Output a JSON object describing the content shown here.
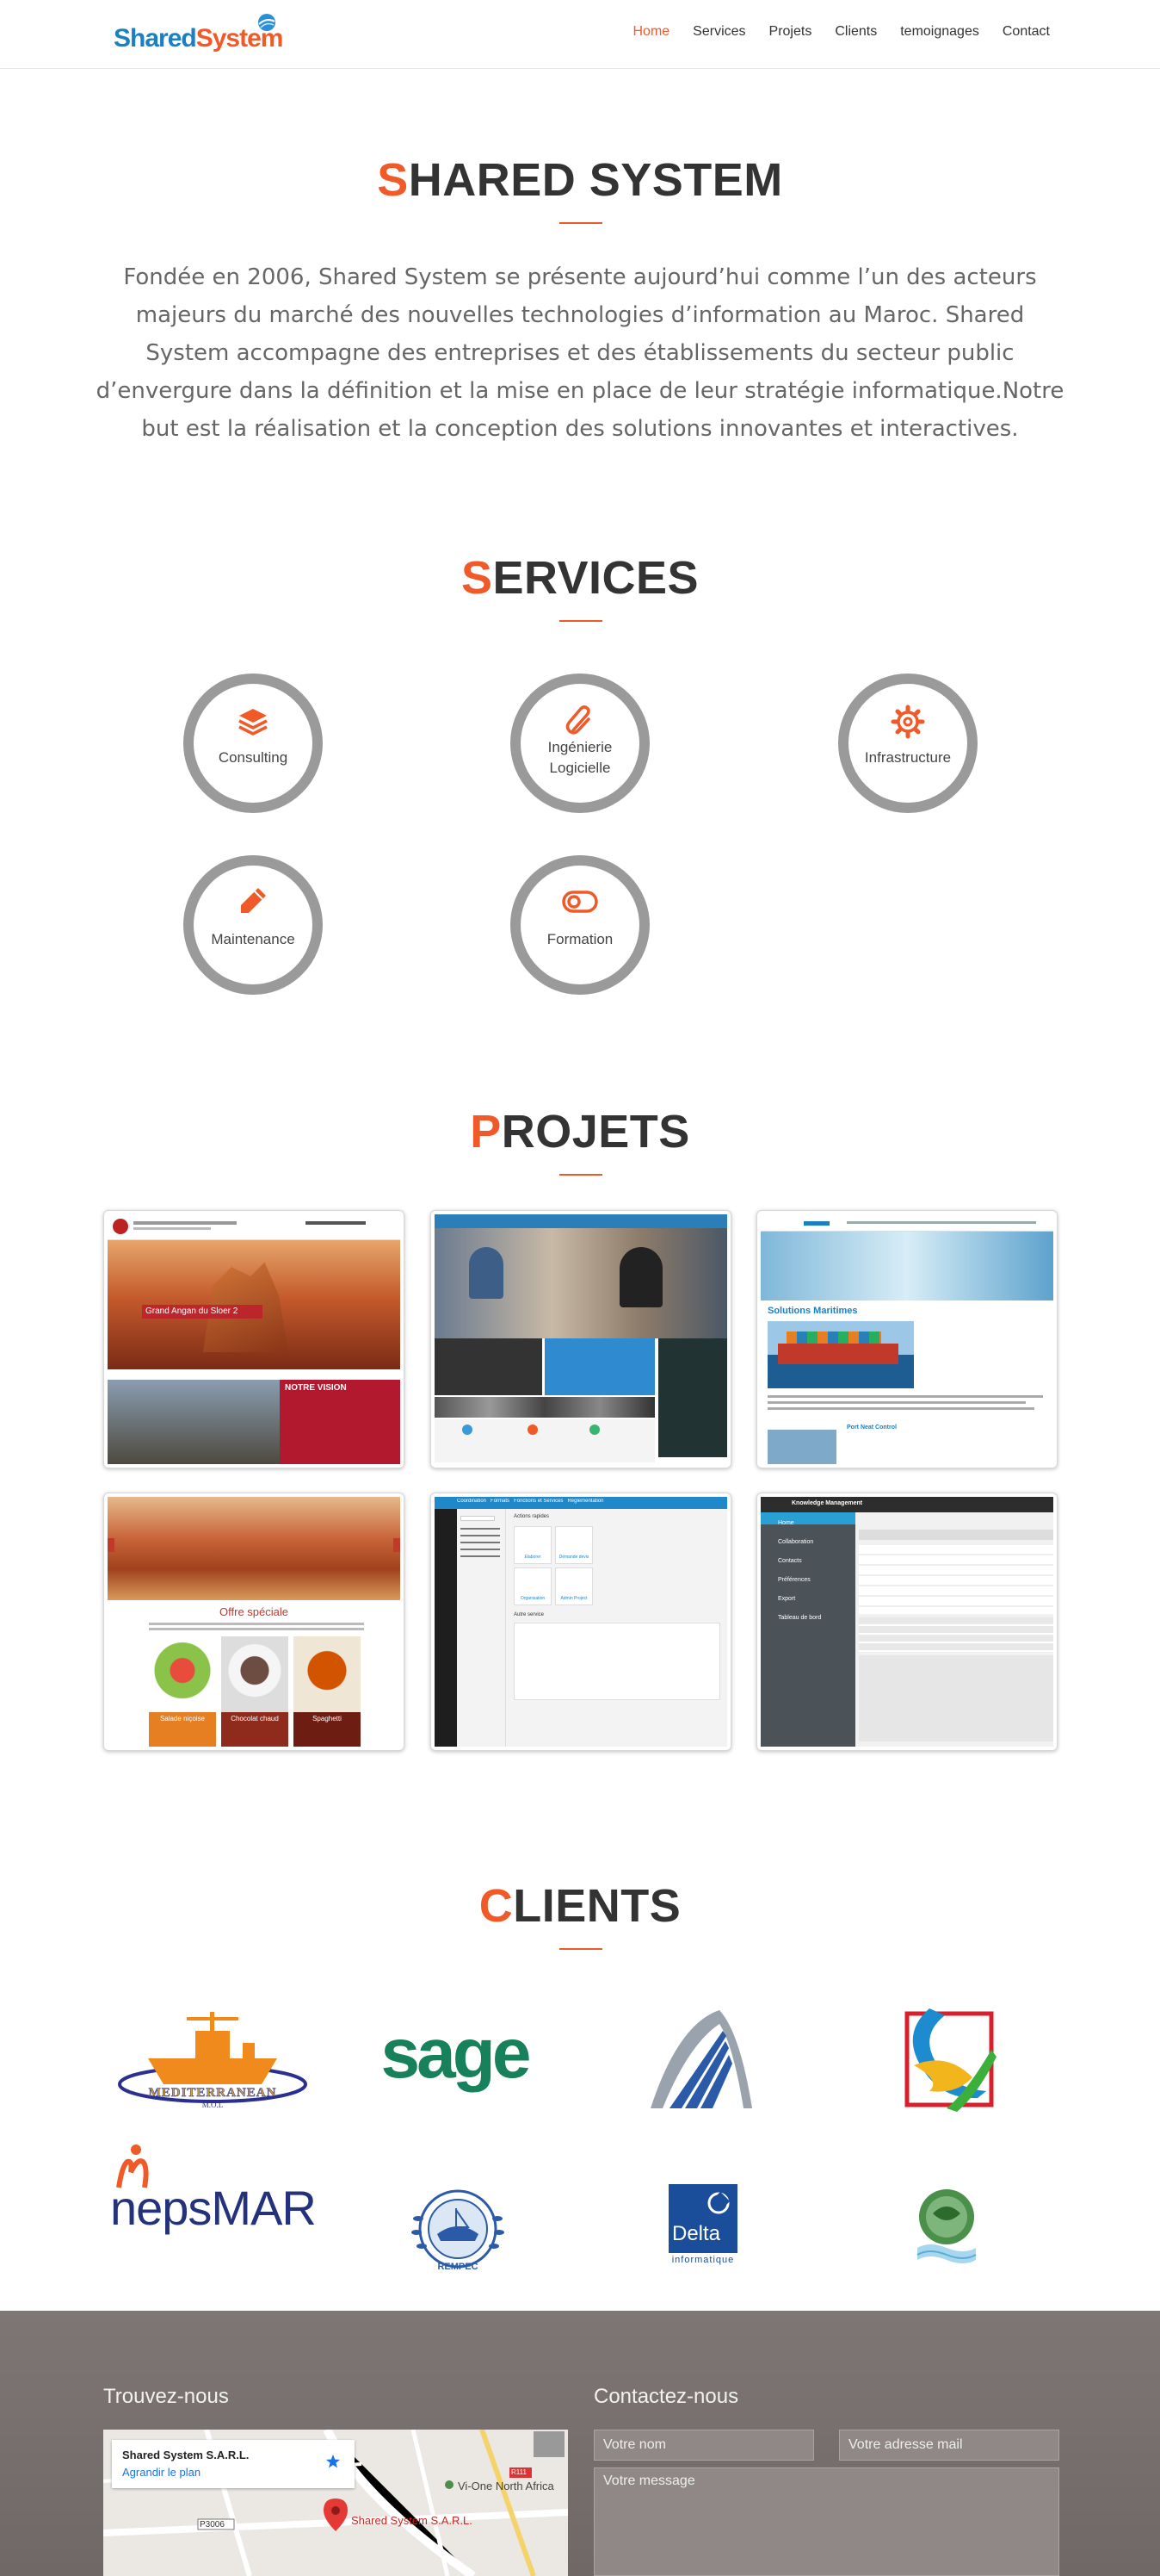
{
  "nav": {
    "logo_part1": "Shared",
    "logo_part2": "System",
    "links": [
      "Home",
      "Services",
      "Projets",
      "Clients",
      "temoignages",
      "Contact"
    ]
  },
  "about": {
    "title_first": "S",
    "title_rest": "HARED SYSTEM",
    "text": "Fondée en 2006, Shared System se présente aujourd’hui comme l’un des acteurs majeurs du marché des nouvelles technologies d’information au Maroc. Shared System accompagne des entreprises et des établissements du secteur public d’envergure dans la définition et la mise en place de leur stratégie informatique.Notre but est la réalisation et la conception des solutions innovantes et interactives."
  },
  "services": {
    "title_first": "S",
    "title_rest": "ERVICES",
    "items": [
      {
        "label": "Consulting",
        "icon": "layers-icon"
      },
      {
        "label": "Ingénierie Logicielle",
        "icon": "paperclip-icon"
      },
      {
        "label": "Infrastructure",
        "icon": "gear-icon"
      },
      {
        "label": "Maintenance",
        "icon": "pencil-icon"
      },
      {
        "label": "Formation",
        "icon": "toggle-icon"
      }
    ]
  },
  "projects": {
    "title_first": "P",
    "title_rest": "ROJETS",
    "p1": {
      "banner": "Grand Angan du Sloer 2",
      "section": "NOTRE VISION"
    },
    "p3": {
      "heading": "Solutions Maritimes",
      "sub": "Port Neat Control"
    },
    "p4": {
      "heading": "Offre spéciale",
      "items": [
        "Salade niçoise",
        "Chocolat chaud",
        "Spaghetti"
      ]
    },
    "p5": {
      "menu": [
        "Coordination",
        "Formats",
        "Fonctions et Services",
        "Réglementation"
      ],
      "panel1": "Actions rapides",
      "panel2": "Autre service",
      "tiles": [
        "Elaborer",
        "Demande devis",
        "Organisation",
        "Admin Project"
      ]
    },
    "p6": {
      "title": "Knowledge Management",
      "sidebar": [
        "Home",
        "Collaboration",
        "Contacts",
        "Préférences",
        "Export",
        "Tableau de bord"
      ]
    }
  },
  "clients": {
    "title_first": "C",
    "title_rest": "LIENTS",
    "mediterranean": "MEDITERRANEAN",
    "mediterranean_sub": "M.O.L",
    "sage": "sage",
    "nepsmar": "nepsMAR",
    "rempec": "REMPEC",
    "delta": "Delta",
    "delta_sub": "informatique"
  },
  "footer": {
    "find_title": "Trouvez-nous",
    "contact_title": "Contactez-nous",
    "map_card_title": "Shared System S.A.R.L.",
    "map_card_link": "Agrandir le plan",
    "map_pin_label": "Shared System S.A.R.L.",
    "map_road_label": "Vi-One North Africa",
    "map_road_code": "P3006",
    "map_road_code2": "R111",
    "name_placeholder": "Votre nom",
    "email_placeholder": "Votre adresse mail",
    "message_placeholder": "Votre message"
  },
  "colors": {
    "accent": "#f05a28",
    "logo_blue": "#1b7fc4",
    "circle_gray": "#9a9a9a"
  }
}
